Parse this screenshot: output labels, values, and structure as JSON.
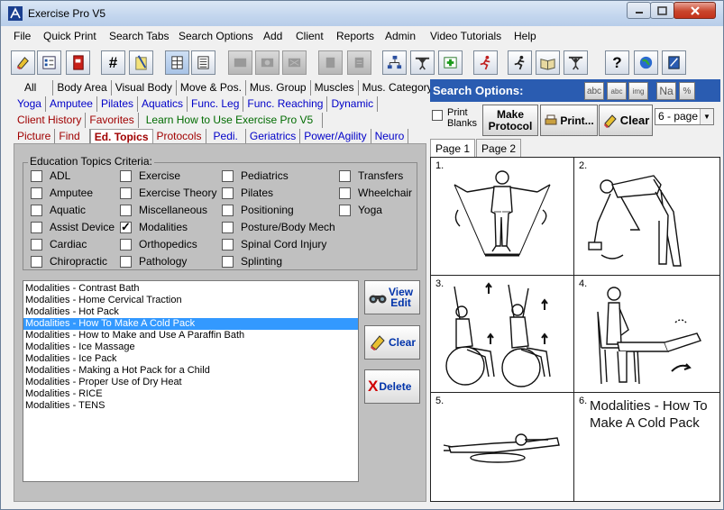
{
  "window": {
    "title": "Exercise Pro V5"
  },
  "menu": [
    "File",
    "Quick Print",
    "Search Tabs",
    "Search Options",
    "Add",
    "Client",
    "Reports",
    "Admin",
    "Video Tutorials",
    "Help"
  ],
  "toolbar": {
    "icons": [
      "eraser-icon",
      "list-icon",
      "book-red-icon",
      "hash-icon",
      "notepad-icon",
      "grid-icon",
      "lines-icon",
      "disabled-1-icon",
      "disabled-2-icon",
      "disabled-3-icon",
      "disabled-4-icon",
      "disabled-5-icon",
      "org-chart-icon",
      "weightlifter-icon",
      "first-aid-icon",
      "runner-red-icon",
      "runner-icon",
      "open-book-icon",
      "weightlifter2-icon",
      "help-icon",
      "globe-icon",
      "manual-icon"
    ],
    "hash_label": "#",
    "help_label": "?"
  },
  "tabs": {
    "row1": [
      "All",
      "Body Area",
      "Visual Body",
      "Move & Pos.",
      "Mus. Group",
      "Muscles",
      "Mus. Category"
    ],
    "row2": [
      "Yoga",
      "Amputee",
      "Pilates",
      "Aquatics",
      "Func. Leg",
      "Func. Reaching",
      "Dynamic"
    ],
    "row3": [
      "Client History",
      "Favorites",
      "Learn How to Use Exercise Pro V5"
    ],
    "row4": [
      "Picture",
      "Find",
      "Ed. Topics",
      "Protocols",
      "Pedi.",
      "Geriatrics",
      "Power/Agility",
      "Neuro"
    ],
    "active": "Ed. Topics"
  },
  "criteria": {
    "legend": "Education Topics Criteria:",
    "columns": [
      [
        {
          "label": "ADL",
          "checked": false
        },
        {
          "label": "Amputee",
          "checked": false
        },
        {
          "label": "Aquatic",
          "checked": false
        },
        {
          "label": "Assist Device",
          "checked": false
        },
        {
          "label": "Cardiac",
          "checked": false
        },
        {
          "label": "Chiropractic",
          "checked": false
        }
      ],
      [
        {
          "label": "Exercise",
          "checked": false
        },
        {
          "label": "Exercise Theory",
          "checked": false
        },
        {
          "label": "Miscellaneous",
          "checked": false
        },
        {
          "label": "Modalities",
          "checked": true
        },
        {
          "label": "Orthopedics",
          "checked": false
        },
        {
          "label": "Pathology",
          "checked": false
        }
      ],
      [
        {
          "label": "Pediatrics",
          "checked": false
        },
        {
          "label": "Pilates",
          "checked": false
        },
        {
          "label": "Positioning",
          "checked": false
        },
        {
          "label": "Posture/Body Mech",
          "checked": false
        },
        {
          "label": "Spinal Cord Injury",
          "checked": false
        },
        {
          "label": "Splinting",
          "checked": false
        }
      ],
      [
        {
          "label": "Transfers",
          "checked": false
        },
        {
          "label": "Wheelchair",
          "checked": false
        },
        {
          "label": "Yoga",
          "checked": false
        }
      ]
    ]
  },
  "topics": {
    "items": [
      "Modalities - Contrast Bath",
      "Modalities - Home Cervical Traction",
      "Modalities - Hot Pack",
      "Modalities - How To Make A Cold Pack",
      "Modalities - How to Make and Use A Paraffin Bath",
      "Modalities - Ice Massage",
      "Modalities - Ice Pack",
      "Modalities - Making a Hot Pack for a Child",
      "Modalities - Proper Use of Dry Heat",
      "Modalities - RICE",
      "Modalities - TENS"
    ],
    "selected_index": 3
  },
  "side_buttons": {
    "view_edit": [
      "View",
      "Edit"
    ],
    "clear": "Clear",
    "delete_x": "X",
    "delete": "Delete"
  },
  "search_options": {
    "title": "Search Options:",
    "icons": [
      "abc",
      "abc",
      "img",
      "Na",
      "%"
    ],
    "print_blanks": [
      "Print",
      "Blanks"
    ],
    "make_protocol": [
      "Make",
      "Protocol"
    ],
    "print": "Print...",
    "clear": "Clear",
    "page_layout": "6 - page"
  },
  "sheet": {
    "tabs": [
      "Page 1",
      "Page 2"
    ],
    "active_tab": "Page 1",
    "cells": [
      "1.",
      "2.",
      "3.",
      "4.",
      "5.",
      "6."
    ],
    "cell6_title": "Modalities - How To Make A Cold Pack"
  }
}
